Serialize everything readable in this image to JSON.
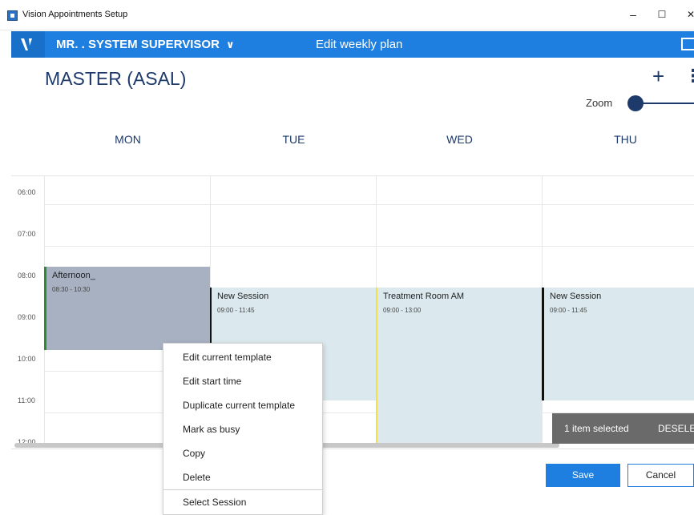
{
  "window": {
    "title": "Vision Appointments Setup",
    "minimize": "–",
    "maximize": "☐",
    "close": "✕"
  },
  "appbar": {
    "user": "MR. . SYSTEM SUPERVISOR",
    "user_chevron": "∨",
    "title": "Edit weekly plan",
    "color": "#1f7fe0"
  },
  "header": {
    "title": "MASTER (ASAL)",
    "add": "+",
    "more": "⋮",
    "zoom_label": "Zoom",
    "zoom_level": 0
  },
  "days": [
    "MON",
    "TUE",
    "WED",
    "THU"
  ],
  "times": [
    "06:00",
    "07:00",
    "08:00",
    "09:00",
    "10:00",
    "11:00",
    "12:00"
  ],
  "events": [
    {
      "day": "MON",
      "name": "Afternoon_",
      "time": "08:30 - 10:30",
      "color": "#a8b1c2",
      "accent": "#2e8b2e"
    },
    {
      "day": "TUE",
      "name": "New Session",
      "time": "09:00 - 11:45",
      "color": "#dbe9ee",
      "accent": "#111111"
    },
    {
      "day": "WED",
      "name": "Treatment Room AM",
      "time": "09:00 - 13:00",
      "color": "#dbe9ee",
      "accent": "#f2e04a"
    },
    {
      "day": "THU",
      "name": "New Session",
      "time": "09:00 - 11:45",
      "color": "#dbe9ee",
      "accent": "#111111"
    }
  ],
  "context_menu": {
    "items": [
      "Edit current template",
      "Edit start time",
      "Duplicate current template",
      "Mark as busy",
      "Copy",
      "Delete",
      "Select Session"
    ]
  },
  "selection_toast": {
    "text": "1 item selected",
    "action": "DESELECT"
  },
  "footer": {
    "save": "Save",
    "cancel": "Cancel"
  }
}
